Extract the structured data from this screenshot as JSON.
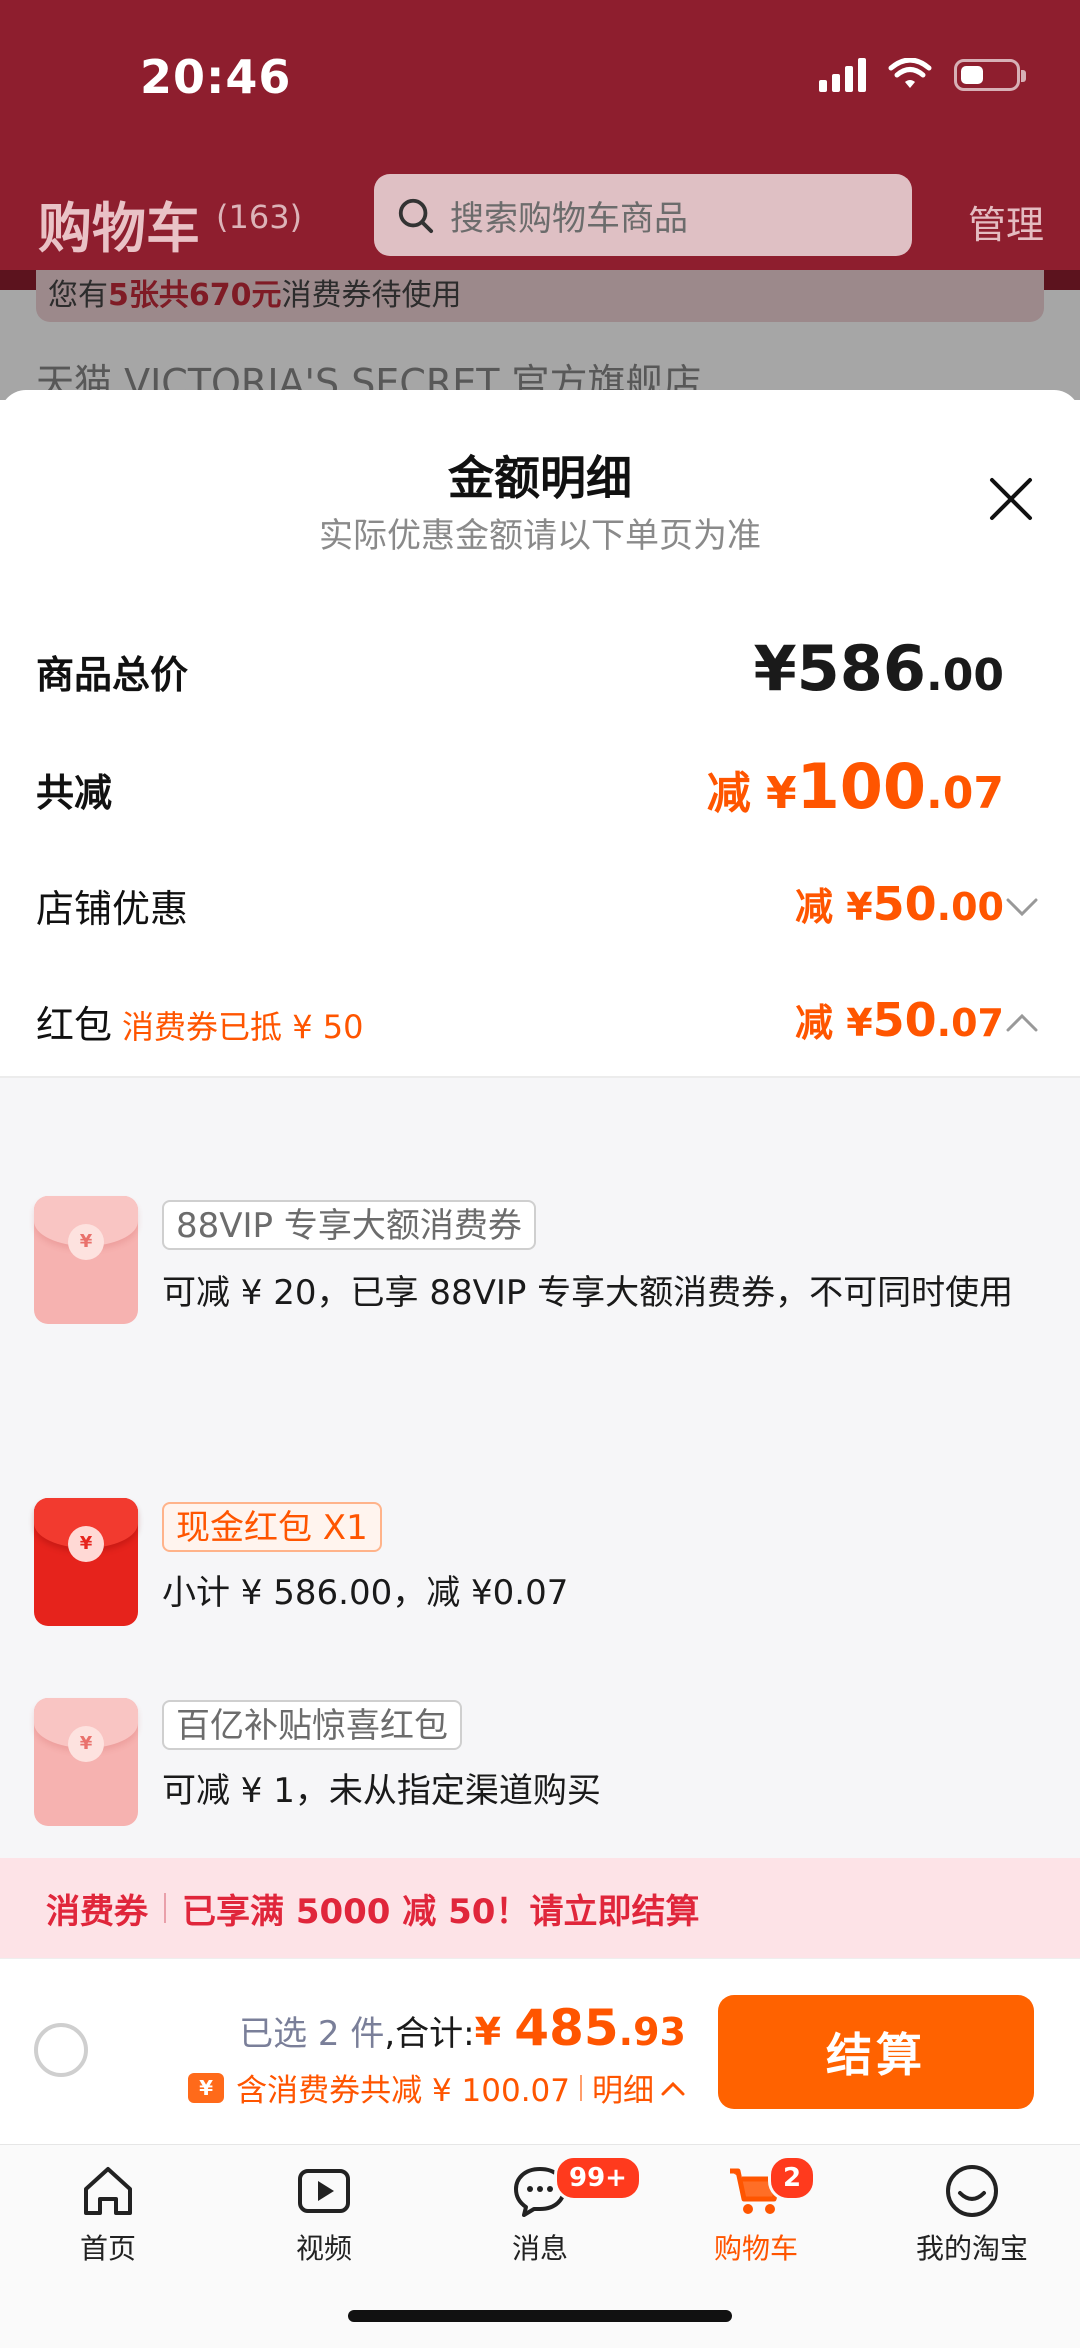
{
  "status_bar": {
    "time": "20:46"
  },
  "header": {
    "title": "购物车",
    "count": "(163)",
    "search_placeholder": "搜索购物车商品",
    "manage": "管理"
  },
  "underlying": {
    "banner_prefix": "您有",
    "banner_highlight": "5张共670元",
    "banner_suffix": "消费券待使用",
    "store_row": "天猫 VICTORIA'S SECRET 官方旗舰店"
  },
  "sheet": {
    "title": "金额明细",
    "subtitle": "实际优惠金额请以下单页为准",
    "rows": {
      "total": {
        "label": "商品总价",
        "currency": "¥",
        "int": "586",
        "dec": ".00"
      },
      "reduce": {
        "label": "共减",
        "prefix": "减 ¥",
        "int": "100",
        "dec": ".07"
      },
      "store": {
        "label": "店铺优惠",
        "prefix": "减 ¥",
        "int": "50",
        "dec": ".00"
      },
      "redpacket": {
        "label": "红包",
        "note": "消费券已抵 ¥ 50",
        "prefix": "减 ¥",
        "int": "50",
        "dec": ".07"
      }
    },
    "items": [
      {
        "tag": "88VIP 专享大额消费券",
        "desc": "可减 ¥ 20，已享 88VIP 专享大额消费券，不可同时使用",
        "coin": "¥"
      },
      {
        "tag": "现金红包 X1",
        "desc": "小计 ¥ 586.00，减 ¥0.07",
        "coin": "¥"
      },
      {
        "tag": "百亿补贴惊喜红包",
        "desc": "可减 ¥ 1，未从指定渠道购买",
        "coin": "¥"
      }
    ]
  },
  "promo": {
    "label": "消费券",
    "text": "已享满 5000 减 50！请立即结算"
  },
  "checkout": {
    "selected": "已选 2 件",
    "total_label": ",合计:",
    "currency": "¥ ",
    "int": "485",
    "dec": ".93",
    "discount_text": "含消费券共减 ¥ 100.07",
    "detail": "明细",
    "button": "结算",
    "discount_icon": "¥"
  },
  "tabbar": {
    "items": [
      {
        "label": "首页",
        "icon": "home-icon"
      },
      {
        "label": "视频",
        "icon": "video-icon"
      },
      {
        "label": "消息",
        "icon": "message-icon",
        "badge": "99+"
      },
      {
        "label": "购物车",
        "icon": "cart-icon",
        "badge": "2",
        "active": true
      },
      {
        "label": "我的淘宝",
        "icon": "profile-icon"
      }
    ]
  },
  "colors": {
    "accent": "#ff5500",
    "header_bg": "#8e1e2e",
    "promo_red": "#e0263b"
  }
}
